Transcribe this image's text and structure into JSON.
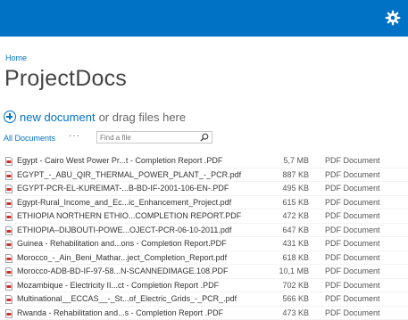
{
  "app": {
    "breadcrumb": "Home",
    "title": "ProjectDocs",
    "new_document": "new document",
    "drag_hint": "or drag files here",
    "view_label": "All Documents",
    "more_label": "···",
    "search_placeholder": "Find a file"
  },
  "colors": {
    "suitebar": "#0072c6",
    "link": "#0072c6"
  },
  "icons": {
    "settings": "gear-icon",
    "search": "search-icon",
    "file": "pdf-file-icon",
    "new": "plus-circle-icon"
  },
  "files": [
    {
      "name": "Egypt - Cairo West Power Pr...t - Completion Report .PDF",
      "size": "5,7 MB",
      "type": "PDF Document"
    },
    {
      "name": "EGYPT_-_ABU_QIR_THERMAL_POWER_PLANT_-_PCR.pdf",
      "size": "887 KB",
      "type": "PDF Document"
    },
    {
      "name": "EGYPT-PCR-EL-KUREIMAT-...B-BD-IF-2001-106-EN-.PDF",
      "size": "495 KB",
      "type": "PDF Document"
    },
    {
      "name": "Egypt-Rural_Income_and_Ec...ic_Enhancement_Project.pdf",
      "size": "615 KB",
      "type": "PDF Document"
    },
    {
      "name": "ETHIOPIA NORTHERN ETHIO...COMPLETION REPORT.PDF",
      "size": "472 KB",
      "type": "PDF Document"
    },
    {
      "name": "ETHIOPIA–DIJBOUTI-POWE...OJECT-PCR-06-10-2011.pdf",
      "size": "647 KB",
      "type": "PDF Document"
    },
    {
      "name": "Guinea - Rehabilitation and...ons - Completion Report.PDF",
      "size": "431 KB",
      "type": "PDF Document"
    },
    {
      "name": "Morocco_-_Ain_Beni_Mathar...ject_Completion_Report.pdf",
      "size": "618 KB",
      "type": "PDF Document"
    },
    {
      "name": "Morocco-ADB-BD-IF-97-58...N-SCANNEDIMAGE.108.PDF",
      "size": "10,1 MB",
      "type": "PDF Document"
    },
    {
      "name": "Mozambique - Electricity II...ct - Completion Report .PDF",
      "size": "702 KB",
      "type": "PDF Document"
    },
    {
      "name": "Multinational__ECCAS__-_St...of_Electric_Grids_-_PCR_.pdf",
      "size": "566 KB",
      "type": "PDF Document"
    },
    {
      "name": "Rwanda - Rehabilitation and...s - Completion Report .PDF",
      "size": "473 KB",
      "type": "PDF Document"
    }
  ]
}
